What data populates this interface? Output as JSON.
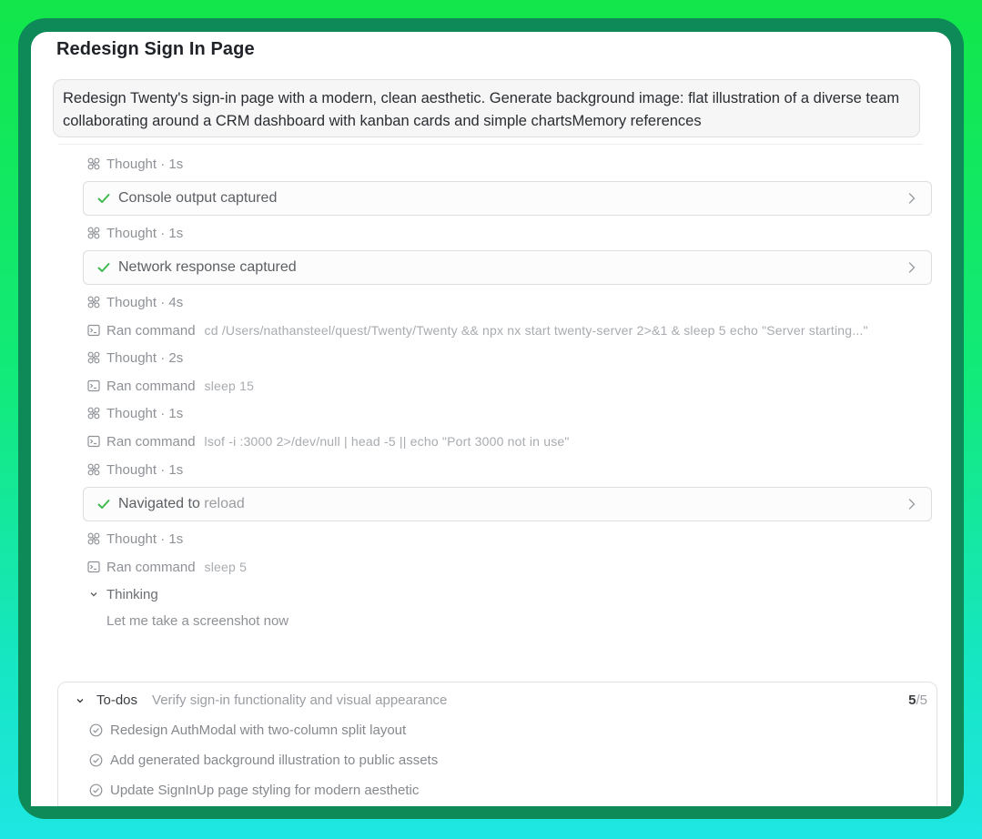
{
  "title": "Redesign Sign In Page",
  "prompt": "Redesign Twenty's sign-in page with a modern, clean aesthetic. Generate background image: flat illustration of a diverse team collaborating around a CRM dashboard with kanban cards and simple chartsMemory references",
  "steps": [
    {
      "label": "Thought · 1s"
    },
    {
      "label": "Console output captured"
    },
    {
      "label": "Thought · 1s"
    },
    {
      "label": "Network response captured"
    },
    {
      "label": "Thought · 4s"
    },
    {
      "label": "Ran command",
      "command": "cd /Users/nathansteel/quest/Twenty/Twenty && npx nx start twenty-server 2>&1 & sleep 5 echo \"Server starting...\""
    },
    {
      "label": "Thought · 2s"
    },
    {
      "label": "Ran command",
      "command": "sleep 15"
    },
    {
      "label": "Thought · 1s"
    },
    {
      "label": "Ran command",
      "command": "lsof -i :3000 2>/dev/null | head -5 || echo \"Port 3000 not in use\""
    },
    {
      "label": "Thought · 1s"
    },
    {
      "label_main": "Navigated to",
      "label_fade": " reload"
    },
    {
      "label": "Thought · 1s"
    },
    {
      "label": "Ran command",
      "command": "sleep 5"
    }
  ],
  "thinking": {
    "label": "Thinking",
    "text": "Let me take a screenshot now"
  },
  "todos": {
    "label": "To-dos",
    "current": "Verify sign-in functionality and visual appearance",
    "done": "5",
    "total": "/5",
    "items": [
      "Redesign AuthModal with two-column split layout",
      "Add generated background illustration to public assets",
      "Update SignInUp page styling for modern aesthetic"
    ]
  },
  "colors": {
    "accent_green": "#3fb950",
    "background_green": "#12e64a",
    "frame": "#0d8a58"
  },
  "icons": [
    "thought-icon",
    "terminal-icon",
    "check-icon",
    "chevron-right-icon",
    "chevron-down-icon",
    "check-circle-icon"
  ]
}
